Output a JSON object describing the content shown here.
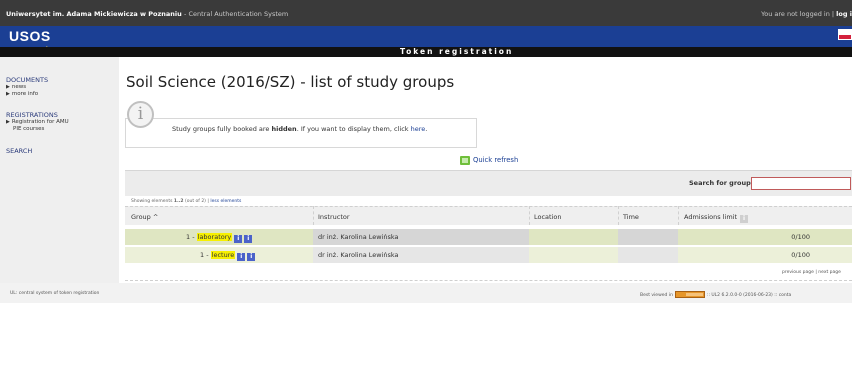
{
  "header": {
    "university": "Uniwersytet im. Adama Mickiewicza w Poznaniu",
    "system": "- Central Authentication System",
    "login_status_prefix": "You are not logged in |",
    "login_link": "log i"
  },
  "brand": {
    "logo_main": "USOS",
    "logo_sub": "ul",
    "banner_title": "Token registration"
  },
  "sidebar": {
    "sections": [
      {
        "label": "DOCUMENTS",
        "items": [
          "news",
          "more info"
        ]
      },
      {
        "label": "REGISTRATIONS",
        "items": [
          "Registration for AMU",
          "PIE courses"
        ]
      },
      {
        "label": "SEARCH",
        "items": []
      }
    ]
  },
  "main": {
    "title": "Soil Science (2016/SZ) - list of study groups",
    "info": {
      "text_before": "Study groups fully booked are ",
      "text_bold": "hidden",
      "text_after": ". If you want to display them, click ",
      "link": "here",
      "end": "."
    },
    "quick_refresh": "Quick refresh",
    "search": {
      "label": "Search for group:",
      "value": ""
    },
    "showing": {
      "prefix": "Showing elements",
      "range": "1..2",
      "suffix": "(out of 2) |",
      "link": "less elements"
    },
    "table": {
      "headers": [
        "Group",
        "Instructor",
        "Location",
        "Time",
        "Admissions limit"
      ],
      "sort_indicator": "^",
      "rows": [
        {
          "num": "1 -",
          "type": "laboratory",
          "instructor": "dr inż. Karolina Lewińska",
          "location": "",
          "time": "",
          "admissions": "0/100"
        },
        {
          "num": "1 -",
          "type": "lecture",
          "instructor": "dr inż. Karolina Lewińska",
          "location": "",
          "time": "",
          "admissions": "0/100"
        }
      ]
    },
    "pager": "previous page | next page"
  },
  "footer": {
    "left": "UL: central system of token registration",
    "best_viewed": "Best viewed in",
    "version": ":: UL2 6.2.0.0-0 (2016-06-23) :: conta"
  },
  "colors": {
    "top_bar": "#3a3a3a",
    "brand_bar": "#1b3f94",
    "highlight": "#f7f000",
    "row_green": "#dfe6c2"
  }
}
